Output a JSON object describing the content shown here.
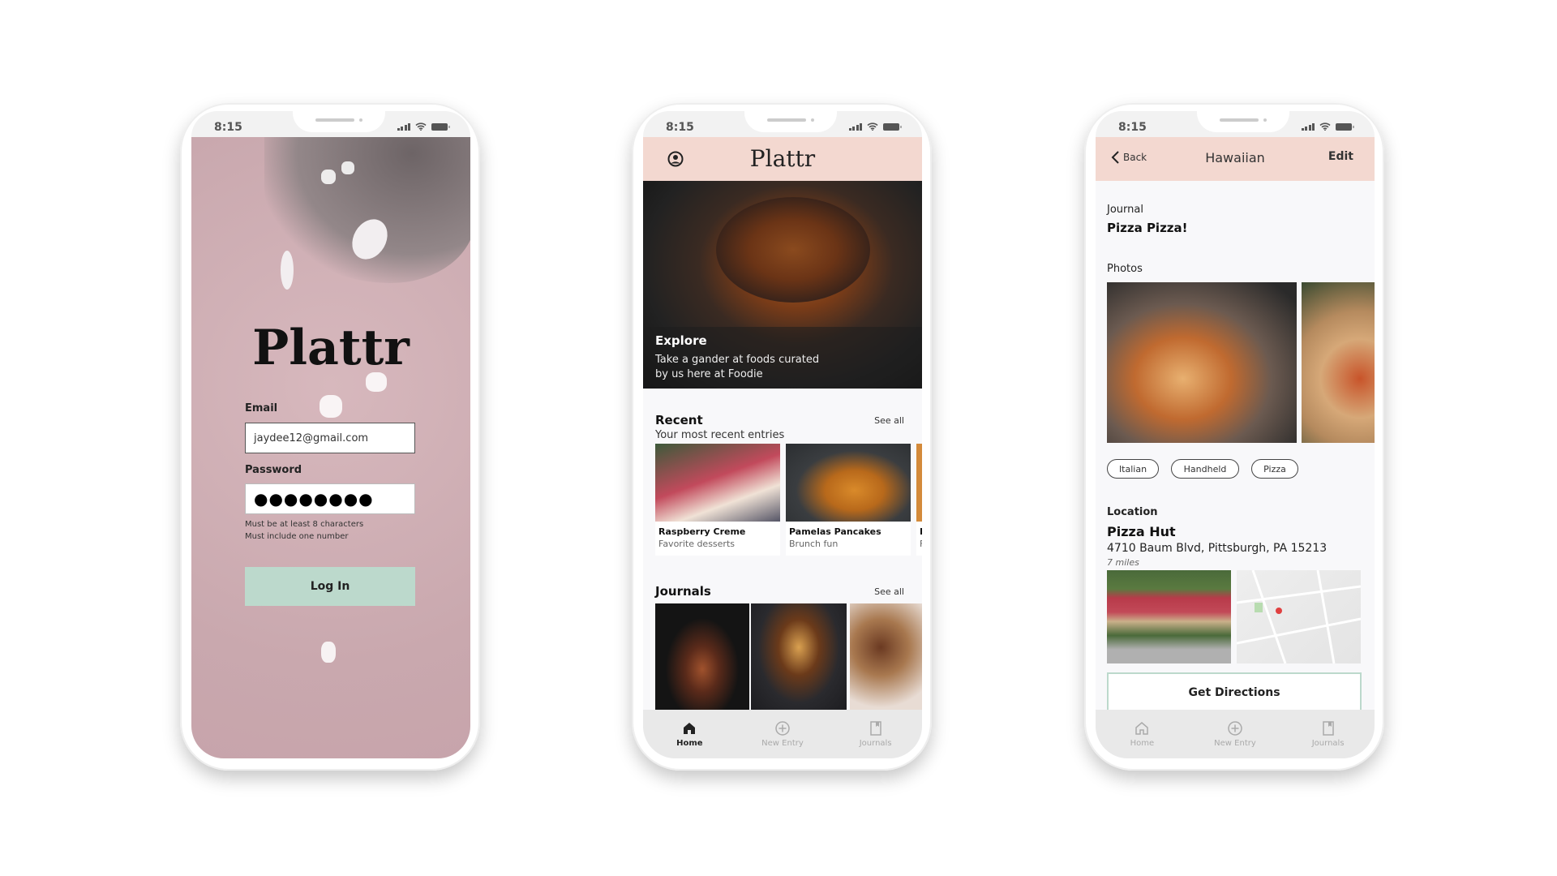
{
  "status": {
    "time": "8:15"
  },
  "login": {
    "logo": "Plattr",
    "email_label": "Email",
    "email_value": "jaydee12@gmail.com",
    "password_label": "Password",
    "password_value": "●●●●●●●●",
    "hints": [
      "Must be at least 8 characters",
      "Must include one number"
    ],
    "login_button": "Log In",
    "colors": {
      "background": "#c9a8ae",
      "button": "#bcd9cc"
    }
  },
  "home": {
    "logo": "Plattr",
    "profile_icon": "user-circle-icon",
    "hero": {
      "title": "Explore",
      "subtitle_line1": "Take a gander at foods curated",
      "subtitle_line2": "by us here at Foodie"
    },
    "recent": {
      "title": "Recent",
      "see_all": "See all",
      "subtitle": "Your most recent entries",
      "cards": [
        {
          "title": "Raspberry Creme",
          "subtitle": "Favorite desserts"
        },
        {
          "title": "Pamelas Pancakes",
          "subtitle": "Brunch fun"
        },
        {
          "title": "P",
          "subtitle": "F"
        }
      ]
    },
    "journals": {
      "title": "Journals",
      "see_all": "See all"
    },
    "header_color": "#f3d8d0"
  },
  "tabs": [
    {
      "label": "Home",
      "icon": "home-icon"
    },
    {
      "label": "New Entry",
      "icon": "plus-circle-icon"
    },
    {
      "label": "Journals",
      "icon": "bookmark-book-icon"
    }
  ],
  "detail": {
    "back": "Back",
    "title": "Hawaiian",
    "edit": "Edit",
    "journal_label": "Journal",
    "journal_name": "Pizza Pizza!",
    "photos_label": "Photos",
    "tags": [
      "Italian",
      "Handheld",
      "Pizza"
    ],
    "location_label": "Location",
    "location_name": "Pizza Hut",
    "address": "4710 Baum Blvd, Pittsburgh, PA 15213",
    "distance": "7 miles",
    "directions_button": "Get Directions"
  }
}
